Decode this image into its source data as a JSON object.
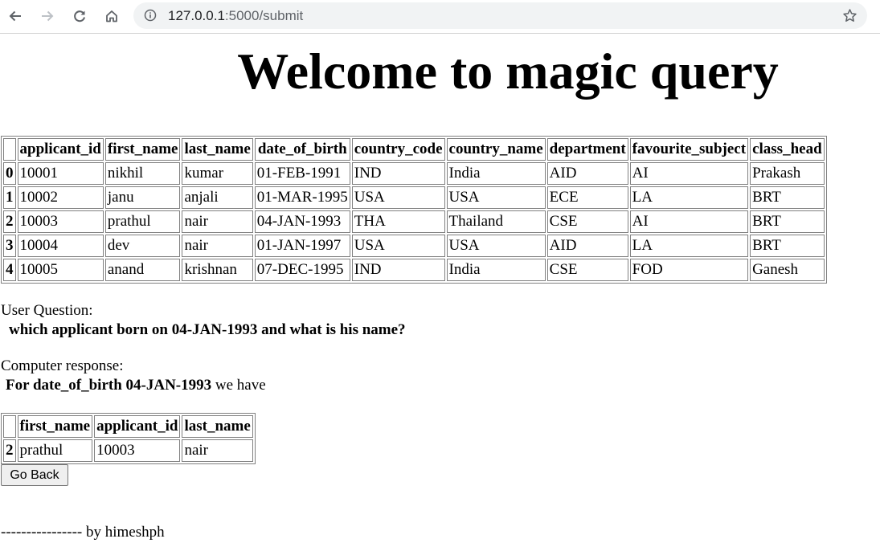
{
  "browser": {
    "url_host": "127.0.0.1",
    "url_path": ":5000/submit"
  },
  "page": {
    "title": "Welcome to magic query"
  },
  "main_table": {
    "columns": [
      "",
      "applicant_id",
      "first_name",
      "last_name",
      "date_of_birth",
      "country_code",
      "country_name",
      "department",
      "favourite_subject",
      "class_head"
    ],
    "rows": [
      [
        "0",
        "10001",
        "nikhil",
        "kumar",
        "01-FEB-1991",
        "IND",
        "India",
        "AID",
        "AI",
        "Prakash"
      ],
      [
        "1",
        "10002",
        "janu",
        "anjali",
        "01-MAR-1995",
        "USA",
        "USA",
        "ECE",
        "LA",
        "BRT"
      ],
      [
        "2",
        "10003",
        "prathul",
        "nair",
        "04-JAN-1993",
        "THA",
        "Thailand",
        "CSE",
        "AI",
        "BRT"
      ],
      [
        "3",
        "10004",
        "dev",
        "nair",
        "01-JAN-1997",
        "USA",
        "USA",
        "AID",
        "LA",
        "BRT"
      ],
      [
        "4",
        "10005",
        "anand",
        "krishnan",
        "07-DEC-1995",
        "IND",
        "India",
        "CSE",
        "FOD",
        "Ganesh"
      ]
    ]
  },
  "question": {
    "label": "User Question:",
    "text": "which applicant born on 04-JAN-1993 and what is his name?"
  },
  "response": {
    "label": "Computer response:",
    "bold_text": "For date_of_birth 04-JAN-1993",
    "tail_text": " we have"
  },
  "result_table": {
    "columns": [
      "",
      "first_name",
      "applicant_id",
      "last_name"
    ],
    "rows": [
      [
        "2",
        "prathul",
        "10003",
        "nair"
      ]
    ]
  },
  "actions": {
    "go_back_label": "Go Back"
  },
  "footer": {
    "text": "---------------- by himeshph"
  }
}
